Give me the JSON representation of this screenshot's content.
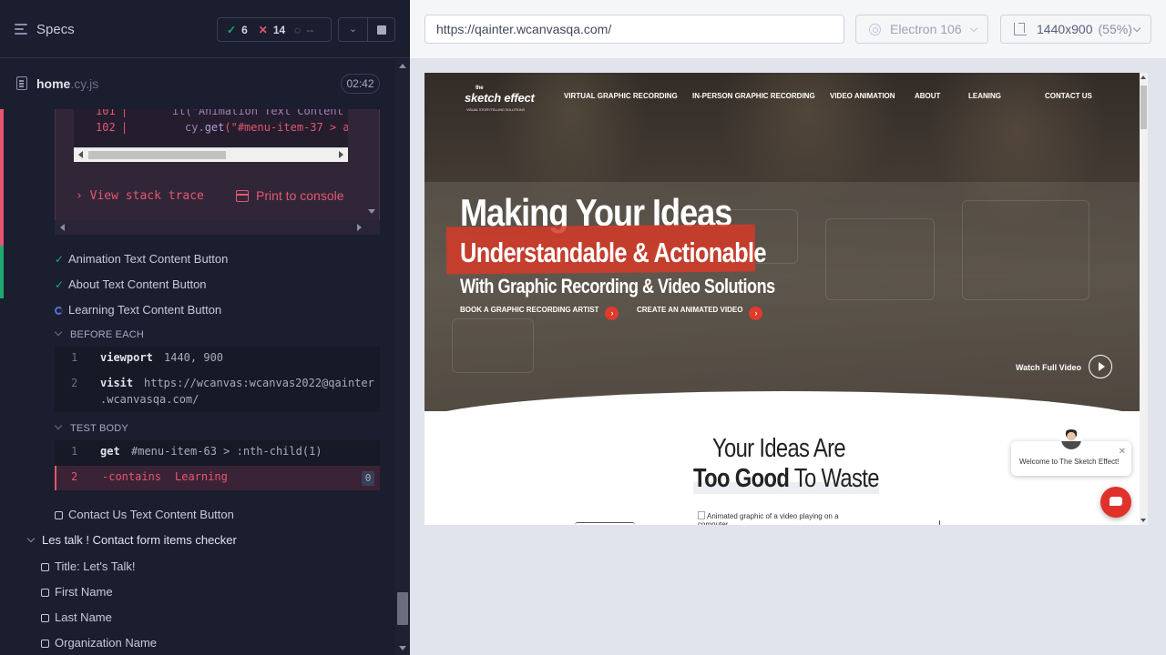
{
  "reporter": {
    "title": "Specs",
    "stats": {
      "passed": "6",
      "failed": "14",
      "pending": "--"
    },
    "spec_file": {
      "name": "home",
      "ext": ".cy.js",
      "duration": "02:42"
    },
    "error": {
      "code_lines": [
        {
          "num": "101",
          "text": "it(\"Animation Text Content"
        },
        {
          "num": "102",
          "pre": "cy.",
          "fn": "get",
          "str": "(\"#menu-item-37 > a"
        }
      ],
      "view_stack_trace": "View stack trace",
      "print_to_console": "Print to console"
    },
    "tests": [
      {
        "label": "Animation Text Content Button",
        "state": "passed"
      },
      {
        "label": "About Text Content Button",
        "state": "passed"
      },
      {
        "label": "Learning Text Content Button",
        "state": "running"
      }
    ],
    "before_each": {
      "label": "BEFORE EACH",
      "commands": [
        {
          "num": "1",
          "name": "viewport",
          "arg": "1440, 900"
        },
        {
          "num": "2",
          "name": "visit",
          "arg": "https://wcanvas:wcanvas2022@qainter",
          "arg2": ".wcanvasqa.com/"
        }
      ]
    },
    "test_body": {
      "label": "TEST BODY",
      "commands": [
        {
          "num": "1",
          "name": "get",
          "arg": "#menu-item-63 > :nth-child(1)"
        },
        {
          "num": "2",
          "name": "-contains",
          "arg": "Learning",
          "badge": "0"
        }
      ]
    },
    "next_test": "Contact Us Text Content Button",
    "suite": {
      "title": "Les talk ! Contact form items checker",
      "tests": [
        "Title: Let's Talk!",
        "First Name",
        "Last Name",
        "Organization Name"
      ]
    }
  },
  "aut": {
    "url": "https://qainter.wcanvasqa.com/",
    "browser": "Electron 106",
    "viewport": "1440x900",
    "scale": "(55%)"
  },
  "site": {
    "logo": {
      "the": "the",
      "main": "sketch effect",
      "tag": "VISUAL STORYTELLING SOLUTIONS"
    },
    "nav": [
      "VIRTUAL GRAPHIC RECORDING",
      "IN-PERSON GRAPHIC RECORDING",
      "VIDEO ANIMATION",
      "ABOUT",
      "LEANING",
      "CONTACT US"
    ],
    "hero": {
      "line1": "Making Your Ideas",
      "line2": "Understandable & Actionable",
      "line3": "With Graphic Recording & Video Solutions",
      "cta1": "BOOK A GRAPHIC RECORDING ARTIST",
      "cta2": "CREATE AN ANIMATED VIDEO",
      "watch": "Watch Full Video"
    },
    "section": {
      "title1": "Your Ideas Are",
      "title2_bold": "Too Good",
      "title2_rest": " To Waste",
      "img_alt": "Animated graphic of a video playing on a computer"
    },
    "chat": {
      "message": "Welcome to The Sketch Effect!"
    }
  }
}
